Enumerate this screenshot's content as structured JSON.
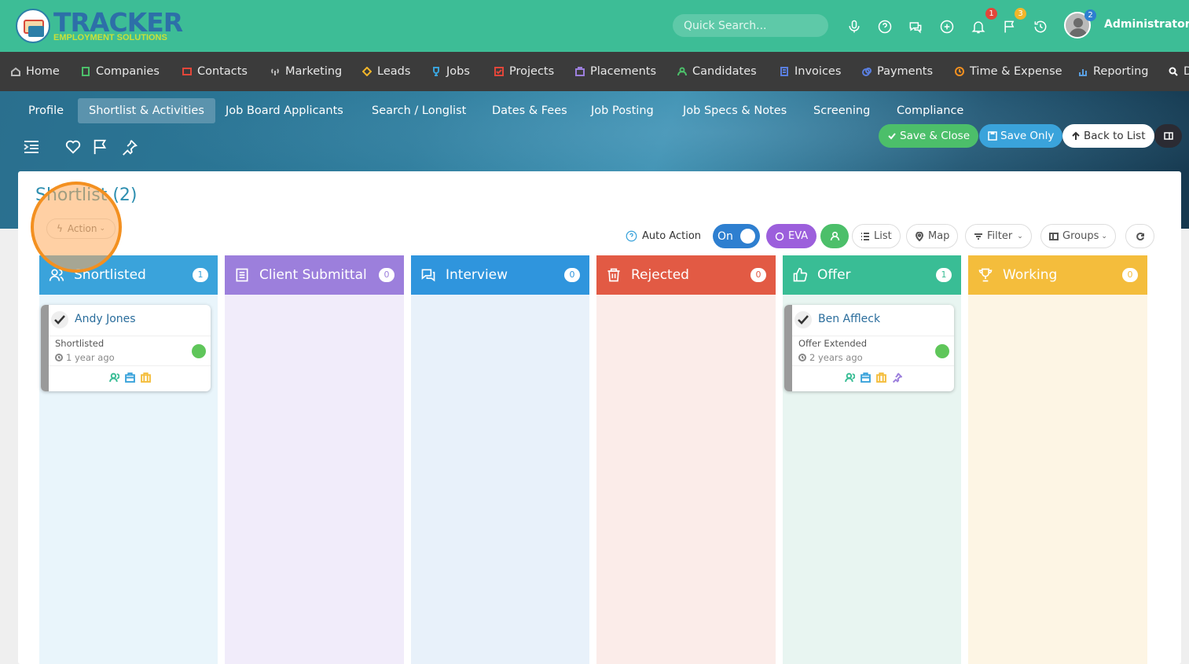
{
  "app": {
    "logo_title": "TRACKER",
    "logo_subtitle": "EMPLOYMENT SOLUTIONS",
    "search_placeholder": "Quick Search...",
    "user_name": "Administrator",
    "badges": {
      "notifications": "1",
      "flags": "3",
      "avatar": "2"
    },
    "colors": {
      "topbar": "#3dbd96",
      "nav": "#3b3b3b",
      "accent": "#2e8fb0"
    }
  },
  "nav": [
    {
      "label": "Home",
      "icon": "home-icon"
    },
    {
      "label": "Companies",
      "icon": "building-icon"
    },
    {
      "label": "Contacts",
      "icon": "contact-card-icon"
    },
    {
      "label": "Marketing",
      "icon": "broadcast-icon"
    },
    {
      "label": "Leads",
      "icon": "diamond-icon"
    },
    {
      "label": "Jobs",
      "icon": "trophy-icon"
    },
    {
      "label": "Projects",
      "icon": "checkbox-icon"
    },
    {
      "label": "Placements",
      "icon": "briefcase-icon"
    },
    {
      "label": "Candidates",
      "icon": "person-icon"
    },
    {
      "label": "Invoices",
      "icon": "document-icon"
    },
    {
      "label": "Payments",
      "icon": "coins-icon"
    },
    {
      "label": "Time & Expense",
      "icon": "clock-icon"
    },
    {
      "label": "Reporting",
      "icon": "bar-chart-icon"
    },
    {
      "label": "D",
      "icon": "search-icon"
    }
  ],
  "tabs": [
    {
      "label": "Profile"
    },
    {
      "label": "Shortlist & Activities",
      "active": true
    },
    {
      "label": "Job Board Applicants"
    },
    {
      "label": "Search / Longlist"
    },
    {
      "label": "Dates & Fees"
    },
    {
      "label": "Job Posting"
    },
    {
      "label": "Job Specs & Notes"
    },
    {
      "label": "Screening"
    },
    {
      "label": "Compliance"
    }
  ],
  "buttons": {
    "save_close": "Save & Close",
    "save_only": "Save Only",
    "back_to_list": "Back to List"
  },
  "panel": {
    "title": "Shortlist (2)",
    "action": "Action",
    "auto_action": "Auto Action",
    "toggle": "On",
    "eva": "EVA",
    "list": "List",
    "map": "Map",
    "filter": "Filter",
    "groups": "Groups"
  },
  "columns": [
    {
      "title": "Shortlisted",
      "count": "1",
      "color": "#3aa3db",
      "body": "#e9f5fb",
      "icon": "people-icon"
    },
    {
      "title": "Client Submittal",
      "count": "0",
      "color": "#9c7fdc",
      "body": "#f1ecfa",
      "icon": "document-list-icon"
    },
    {
      "title": "Interview",
      "count": "0",
      "color": "#2f95dd",
      "body": "#e8f1fa",
      "icon": "chat-bubbles-icon"
    },
    {
      "title": "Rejected",
      "count": "0",
      "color": "#e25a44",
      "body": "#fbece9",
      "icon": "trash-icon"
    },
    {
      "title": "Offer",
      "count": "1",
      "color": "#39bd95",
      "body": "#e8f5f1",
      "icon": "thumbs-up-icon"
    },
    {
      "title": "Working",
      "count": "0",
      "color": "#f4bd3c",
      "body": "#fdf5e4",
      "icon": "trophy-icon"
    }
  ],
  "cards": {
    "shortlisted": {
      "name": "Andy Jones",
      "status": "Shortlisted",
      "time": "1 year ago"
    },
    "offer": {
      "name": "Ben Affleck",
      "status": "Offer Extended",
      "time": "2 years ago"
    }
  }
}
